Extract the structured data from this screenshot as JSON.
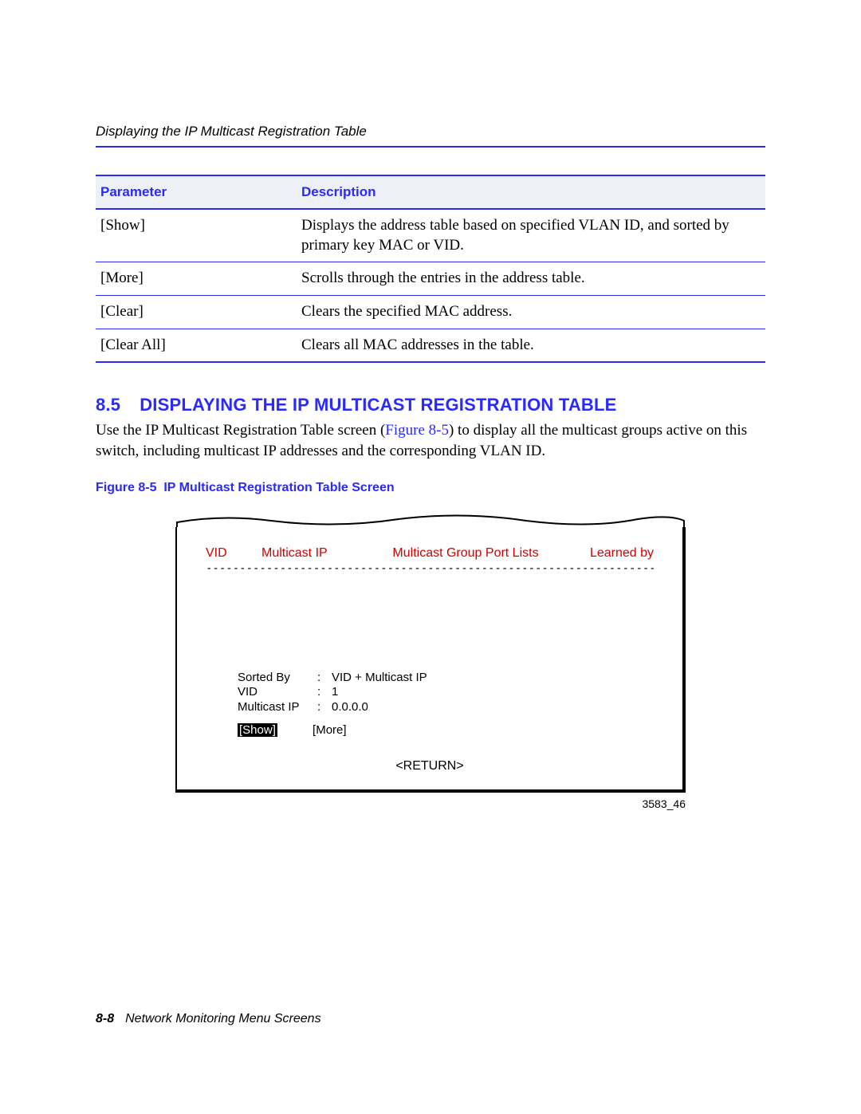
{
  "running_head": "Displaying the IP Multicast Registration Table",
  "table": {
    "headers": {
      "param": "Parameter",
      "desc": "Description"
    },
    "rows": [
      {
        "param": "[Show]",
        "desc": "Displays the address table based on specified VLAN ID, and sorted by primary key MAC or VID."
      },
      {
        "param": "[More]",
        "desc": "Scrolls through the entries in the address table."
      },
      {
        "param": "[Clear]",
        "desc": "Clears the specified MAC address."
      },
      {
        "param": "[Clear All]",
        "desc": "Clears all MAC addresses in the table."
      }
    ]
  },
  "section": {
    "number": "8.5",
    "title": "DISPLAYING THE IP MULTICAST REGISTRATION TABLE",
    "body_pre": "Use the IP Multicast Registration Table screen (",
    "figref": "Figure 8-5",
    "body_post": ") to display all the multicast groups active on this switch, including multicast IP addresses and the corresponding VLAN ID."
  },
  "figure_caption": {
    "label": "Figure 8-5",
    "title": "IP Multicast Registration Table Screen"
  },
  "screen": {
    "headers": {
      "vid": "VID",
      "mip": "Multicast IP",
      "group": "Multicast Group Port Lists",
      "learned": "Learned by"
    },
    "dashes": "-------------------------------------------------------------------------------------------------------",
    "kv": {
      "sorted_by": {
        "k": "Sorted By",
        "v": "VID + Multicast IP"
      },
      "vid": {
        "k": "VID",
        "v": "1"
      },
      "mip": {
        "k": "Multicast IP",
        "v": "0.0.0.0"
      }
    },
    "buttons": {
      "show": "[Show]",
      "more": "[More]"
    },
    "return": "<RETURN>",
    "image_num": "3583_46"
  },
  "footer": {
    "page": "8-8",
    "title": "Network Monitoring Menu Screens"
  }
}
